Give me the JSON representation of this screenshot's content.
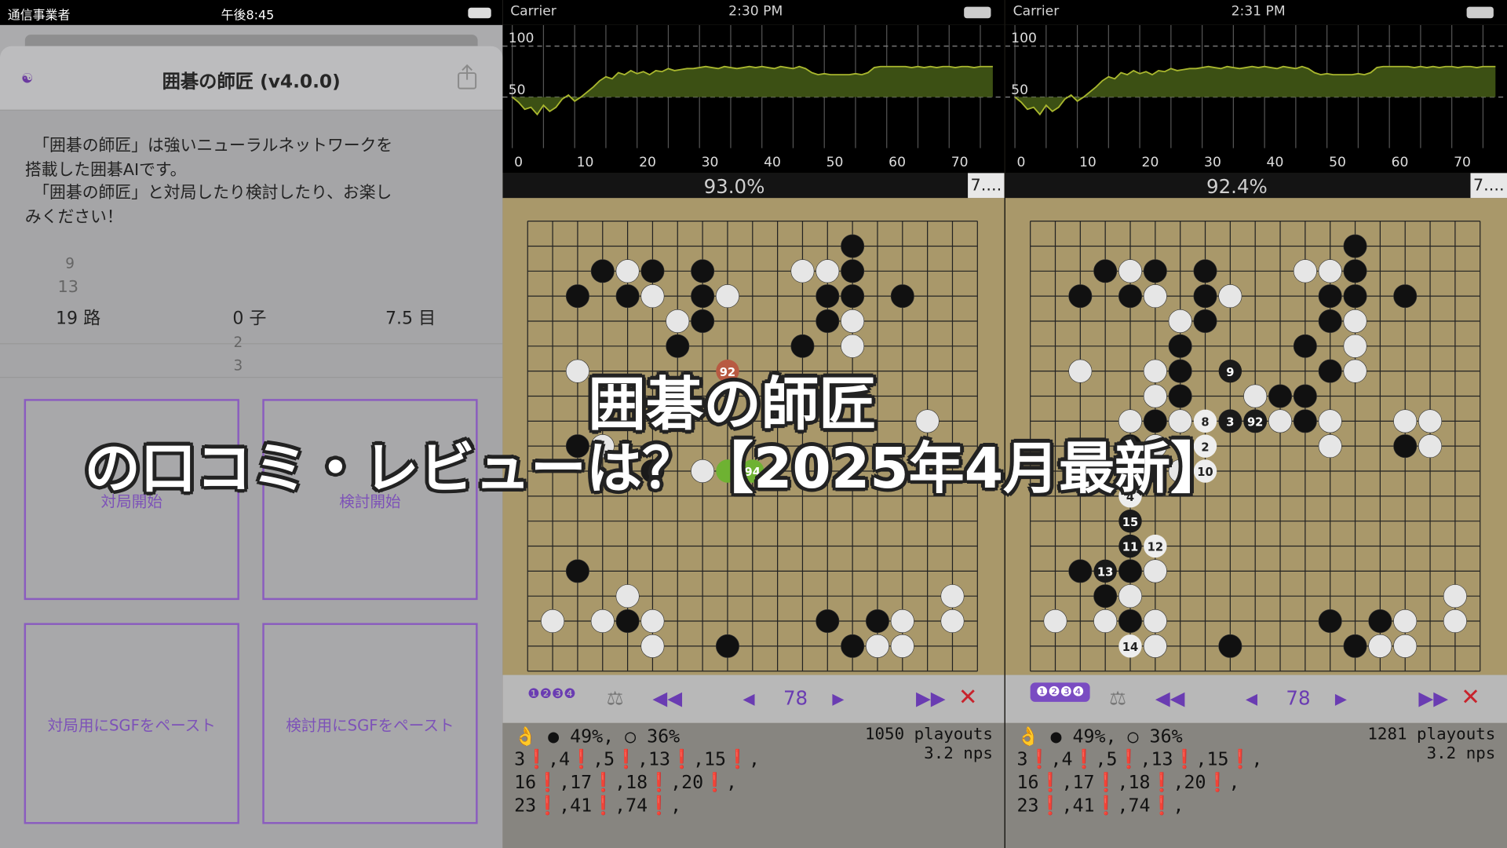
{
  "left": {
    "status": {
      "carrier": "通信事業者",
      "time": "午後8:45"
    },
    "title": "囲碁の師匠 (v4.0.0)",
    "intro_lines": [
      "　「囲碁の師匠」は強いニューラルネットワークを",
      "搭載した囲碁AIです。",
      "　「囲碁の師匠」と対局したり検討したり、お楽し",
      "みください！"
    ],
    "picker": {
      "board_sizes": [
        "9",
        "13",
        "19 路"
      ],
      "handicap": [
        "0 子",
        "2",
        "3"
      ],
      "komi": "7.5 目"
    },
    "buttons": {
      "start_game": "対局開始",
      "start_review": "検討開始",
      "paste_game": "対局用にSGFをペースト",
      "paste_review": "検討用にSGFをペースト"
    }
  },
  "panels": [
    {
      "status": {
        "carrier": "Carrier",
        "time": "2:30 PM"
      },
      "winrate": "93.0%",
      "komi": "7....",
      "move_number": "78",
      "stats": "● 49%, ○ 36%",
      "playouts": "1050 playouts",
      "nps": "3.2 nps",
      "bad_moves": [
        "3❗,4❗,5❗,13❗,15❗,",
        "16❗,17❗,18❗,20❗,",
        "23❗,41❗,74❗,"
      ]
    },
    {
      "status": {
        "carrier": "Carrier",
        "time": "2:31 PM"
      },
      "winrate": "92.4%",
      "komi": "7....",
      "move_number": "78",
      "stats": "● 49%, ○ 36%",
      "playouts": "1281 playouts",
      "nps": "3.2 nps",
      "bad_moves": [
        "3❗,4❗,5❗,13❗,15❗,",
        "16❗,17❗,18❗,20❗,",
        "23❗,41❗,74❗,"
      ]
    }
  ],
  "chart": {
    "y_labels": [
      "100",
      "50"
    ],
    "x_labels": [
      "0",
      "10",
      "20",
      "30",
      "40",
      "50",
      "60",
      "70"
    ],
    "winrate_series": [
      50,
      45,
      38,
      40,
      33,
      42,
      36,
      40,
      48,
      52,
      46,
      50,
      55,
      60,
      66,
      70,
      68,
      74,
      72,
      76,
      73,
      75,
      72,
      76,
      75,
      78,
      76,
      77,
      78,
      78,
      79,
      80,
      79,
      78,
      80,
      79,
      78,
      79,
      80,
      79,
      80,
      79,
      78,
      80,
      79,
      78,
      80,
      78,
      74,
      72,
      73,
      72,
      72,
      72,
      72,
      73,
      72,
      74,
      79,
      80,
      80,
      80,
      80,
      80,
      79,
      80,
      79,
      80,
      79,
      80,
      80,
      79,
      80,
      80,
      79,
      80,
      80,
      80
    ]
  },
  "overlay": {
    "line1": "囲碁の師匠",
    "line2": "の口コミ・レビューは？【2025年4月最新】"
  },
  "colors": {
    "accent": "#7d52b8",
    "chart_fill": "#3c5014",
    "chart_line": "#a9b72e",
    "board": "#a9986a"
  }
}
